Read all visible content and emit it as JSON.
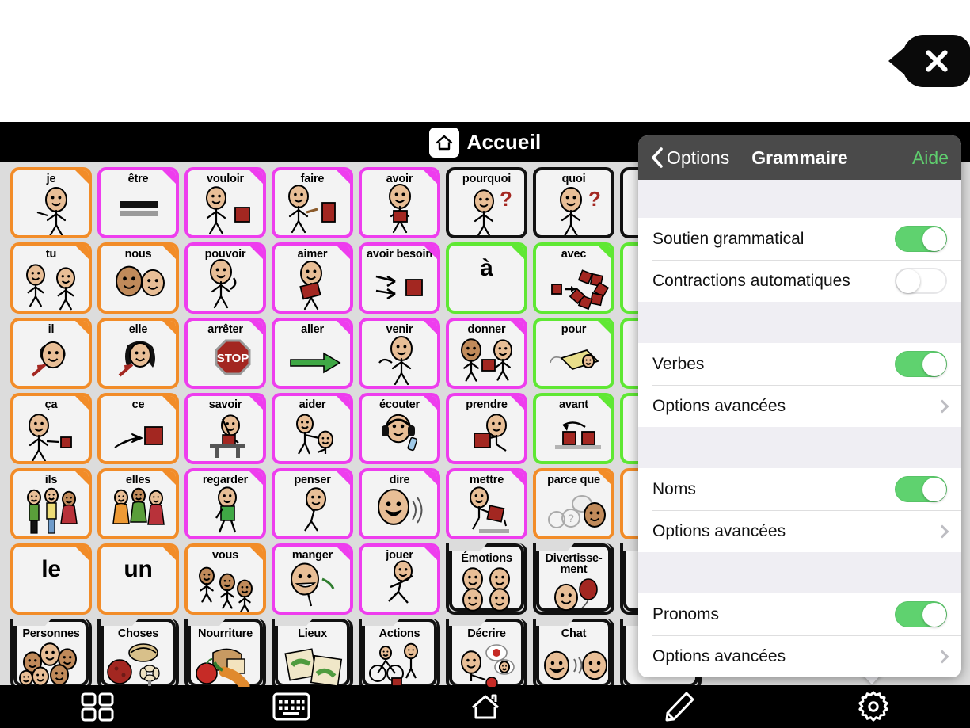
{
  "close_button": {
    "icon": "close-icon"
  },
  "app": {
    "header": {
      "icon": "home-icon",
      "title": "Accueil"
    },
    "toolbar": [
      {
        "name": "grid-view-button",
        "icon": "grid-icon"
      },
      {
        "name": "keyboard-button",
        "icon": "keyboard-icon"
      },
      {
        "name": "home-button",
        "icon": "home-icon"
      },
      {
        "name": "edit-button",
        "icon": "pencil-icon"
      },
      {
        "name": "settings-button",
        "icon": "gear-icon"
      }
    ]
  },
  "grid": {
    "columns": 8,
    "rows": 7,
    "colors": {
      "pronoun": "#F28C28",
      "verb": "#EE3DEE",
      "question": "#111111",
      "preposition": "#5FE833",
      "folder": "#111111"
    },
    "cells": [
      {
        "label": "je",
        "color": "#F28C28",
        "art": "person-pointing-self",
        "folded": true
      },
      {
        "label": "être",
        "color": "#EE3DEE",
        "art": "equals-lines",
        "folded": true
      },
      {
        "label": "vouloir",
        "color": "#EE3DEE",
        "art": "person-reaching-block",
        "folded": true
      },
      {
        "label": "faire",
        "color": "#EE3DEE",
        "art": "person-hammer-block",
        "folded": true
      },
      {
        "label": "avoir",
        "color": "#EE3DEE",
        "art": "person-holding-block",
        "folded": true
      },
      {
        "label": "pourquoi",
        "color": "#111111",
        "art": "person-thinking-question",
        "folded": false
      },
      {
        "label": "quoi",
        "color": "#111111",
        "art": "person-shrug-question",
        "folded": false
      },
      {
        "label": "",
        "color": "#111111",
        "art": "",
        "folded": false
      },
      {
        "label": "tu",
        "color": "#F28C28",
        "art": "two-people-pointing",
        "folded": true
      },
      {
        "label": "nous",
        "color": "#F28C28",
        "art": "two-faces",
        "folded": true
      },
      {
        "label": "pouvoir",
        "color": "#EE3DEE",
        "art": "person-flexing",
        "folded": true
      },
      {
        "label": "aimer",
        "color": "#EE3DEE",
        "art": "person-hugging-heart",
        "folded": true
      },
      {
        "label": "avoir besoin",
        "color": "#EE3DEE",
        "art": "hands-reaching-block",
        "folded": true
      },
      {
        "label": "à",
        "color": "#5FE833",
        "art": "",
        "folded": true,
        "bigword": true
      },
      {
        "label": "avec",
        "color": "#5FE833",
        "art": "blocks-joining",
        "folded": true
      },
      {
        "label": "",
        "color": "#5FE833",
        "art": "",
        "folded": true
      },
      {
        "label": "il",
        "color": "#F28C28",
        "art": "boy-face-arrow",
        "folded": true
      },
      {
        "label": "elle",
        "color": "#F28C28",
        "art": "girl-face-arrow",
        "folded": true
      },
      {
        "label": "arrêter",
        "color": "#EE3DEE",
        "art": "stop-sign",
        "folded": true
      },
      {
        "label": "aller",
        "color": "#EE3DEE",
        "art": "green-arrow",
        "folded": true
      },
      {
        "label": "venir",
        "color": "#EE3DEE",
        "art": "person-beckoning",
        "folded": true
      },
      {
        "label": "donner",
        "color": "#EE3DEE",
        "art": "two-people-handing-block",
        "folded": true
      },
      {
        "label": "pour",
        "color": "#5FE833",
        "art": "gift-tag",
        "folded": true
      },
      {
        "label": "",
        "color": "#5FE833",
        "art": "",
        "folded": true
      },
      {
        "label": "ça",
        "color": "#F28C28",
        "art": "person-pointing-block",
        "folded": true
      },
      {
        "label": "ce",
        "color": "#F28C28",
        "art": "hand-pointing-block",
        "folded": true
      },
      {
        "label": "savoir",
        "color": "#EE3DEE",
        "art": "person-raising-hand-desk",
        "folded": true
      },
      {
        "label": "aider",
        "color": "#EE3DEE",
        "art": "person-helping-person",
        "folded": true
      },
      {
        "label": "écouter",
        "color": "#EE3DEE",
        "art": "person-headphones",
        "folded": true
      },
      {
        "label": "prendre",
        "color": "#EE3DEE",
        "art": "person-taking-block",
        "folded": true
      },
      {
        "label": "avant",
        "color": "#5FE833",
        "art": "two-blocks-arrow",
        "folded": true
      },
      {
        "label": "",
        "color": "#5FE833",
        "art": "",
        "folded": true
      },
      {
        "label": "ils",
        "color": "#F28C28",
        "art": "group-men",
        "folded": true
      },
      {
        "label": "elles",
        "color": "#F28C28",
        "art": "group-women",
        "folded": true
      },
      {
        "label": "regarder",
        "color": "#EE3DEE",
        "art": "person-walking-looking",
        "folded": true
      },
      {
        "label": "penser",
        "color": "#EE3DEE",
        "art": "person-thinking",
        "folded": true
      },
      {
        "label": "dire",
        "color": "#EE3DEE",
        "art": "face-speaking",
        "folded": true
      },
      {
        "label": "mettre",
        "color": "#EE3DEE",
        "art": "person-placing-block",
        "folded": true
      },
      {
        "label": "parce que",
        "color": "#F28C28",
        "art": "speech-bubbles-question",
        "folded": true
      },
      {
        "label": "",
        "color": "#F28C28",
        "art": "",
        "folded": true
      },
      {
        "label": "le",
        "color": "#F28C28",
        "art": "",
        "folded": true,
        "bigword": true
      },
      {
        "label": "un",
        "color": "#F28C28",
        "art": "",
        "folded": true,
        "bigword": true
      },
      {
        "label": "vous",
        "color": "#F28C28",
        "art": "three-people-pointing",
        "folded": true
      },
      {
        "label": "manger",
        "color": "#EE3DEE",
        "art": "person-eating",
        "folded": true
      },
      {
        "label": "jouer",
        "color": "#EE3DEE",
        "art": "person-playing",
        "folded": true
      },
      {
        "label": "Émotions",
        "color": "#111111",
        "art": "four-emotion-faces",
        "folder": true
      },
      {
        "label": "Divertisse-ment",
        "color": "#111111",
        "art": "face-balloon",
        "folder": true
      },
      {
        "label": "",
        "color": "#111111",
        "art": "",
        "folder": true
      },
      {
        "label": "Personnes",
        "color": "#111111",
        "art": "many-faces",
        "folder": true
      },
      {
        "label": "Choses",
        "color": "#111111",
        "art": "ball-basket-fan",
        "folder": true
      },
      {
        "label": "Nourriture",
        "color": "#111111",
        "art": "bread-apple-carrot",
        "folder": true
      },
      {
        "label": "Lieux",
        "color": "#111111",
        "art": "maps",
        "folder": true
      },
      {
        "label": "Actions",
        "color": "#111111",
        "art": "bike-walk-block",
        "folder": true
      },
      {
        "label": "Décrire",
        "color": "#111111",
        "art": "person-describing-apple",
        "folder": true
      },
      {
        "label": "Chat",
        "color": "#111111",
        "art": "two-faces-talking",
        "folder": true
      },
      {
        "label": "",
        "color": "#111111",
        "art": "",
        "folder": true
      }
    ]
  },
  "popover": {
    "nav": {
      "back_label": "Options",
      "title": "Grammaire",
      "help_label": "Aide",
      "back_icon": "chevron-left-icon"
    },
    "sections": [
      {
        "rows": [
          {
            "label": "Soutien grammatical",
            "type": "toggle",
            "value": "on"
          },
          {
            "label": "Contractions automatiques",
            "type": "toggle",
            "value": "off"
          }
        ]
      },
      {
        "rows": [
          {
            "label": "Verbes",
            "type": "toggle",
            "value": "on"
          },
          {
            "label": "Options avancées",
            "type": "disclosure"
          }
        ]
      },
      {
        "rows": [
          {
            "label": "Noms",
            "type": "toggle",
            "value": "on"
          },
          {
            "label": "Options avancées",
            "type": "disclosure"
          }
        ]
      },
      {
        "rows": [
          {
            "label": "Pronoms",
            "type": "toggle",
            "value": "on"
          },
          {
            "label": "Options avancées",
            "type": "disclosure"
          }
        ]
      }
    ],
    "accent_green": "#5FD26F",
    "nav_background": "#4A4A4A"
  }
}
